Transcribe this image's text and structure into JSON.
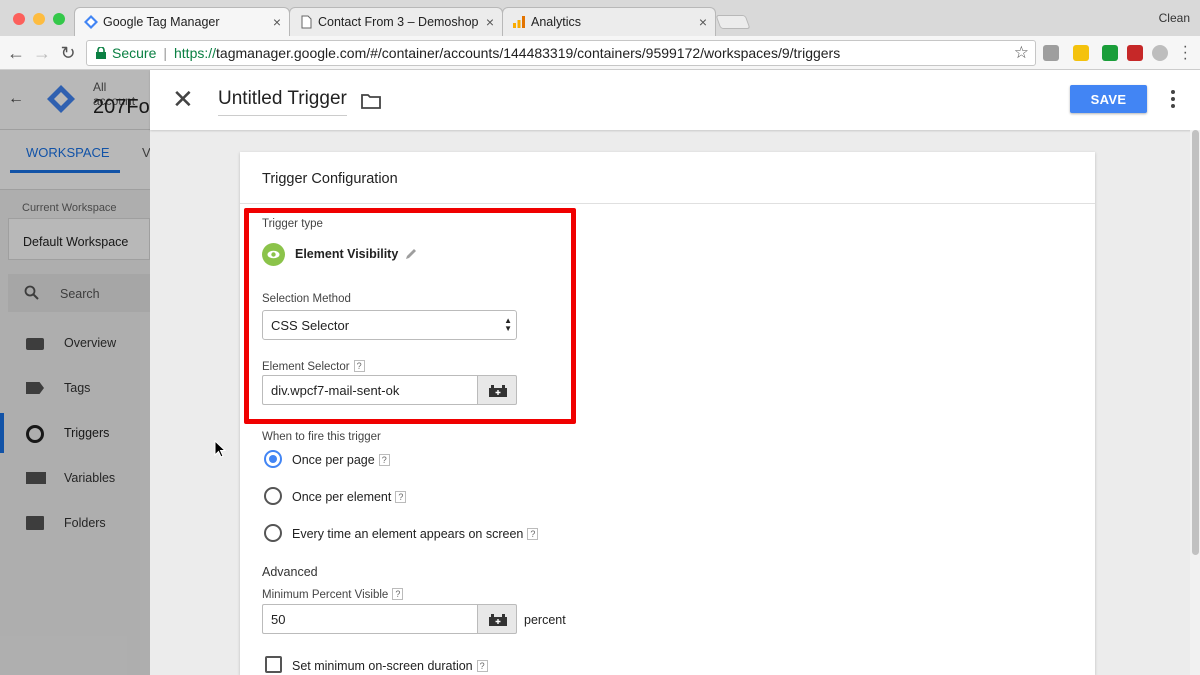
{
  "browser": {
    "tabs": [
      {
        "title": "Google Tag Manager",
        "active": true
      },
      {
        "title": "Contact From 3 – Demoshop",
        "active": false
      },
      {
        "title": "Analytics",
        "active": false
      }
    ],
    "profile_name": "Clean",
    "secure_label": "Secure",
    "url_scheme": "https://",
    "url_rest": "tagmanager.google.com/#/container/accounts/144483319/containers/9599172/workspaces/9/triggers"
  },
  "gtm": {
    "trigger_name": "Untitled Trigger",
    "save_label": "SAVE",
    "card_title": "Trigger Configuration",
    "trigger_type_label": "Trigger type",
    "trigger_type_value": "Element Visibility",
    "selection_method_label": "Selection Method",
    "selection_method_value": "CSS Selector",
    "element_selector_label": "Element Selector",
    "element_selector_value": "div.wpcf7-mail-sent-ok",
    "fire_label": "When to fire this trigger",
    "fire_options": [
      {
        "label": "Once per page",
        "selected": true
      },
      {
        "label": "Once per element",
        "selected": false
      },
      {
        "label": "Every time an element appears on screen",
        "selected": false
      }
    ],
    "advanced_label": "Advanced",
    "min_percent_label": "Minimum Percent Visible",
    "min_percent_value": "50",
    "percent_suffix": "percent",
    "min_duration_label": "Set minimum on-screen duration",
    "help_glyph": "?"
  },
  "colors": {
    "accent": "#4285f4",
    "highlight_box": "#f00000",
    "trigger_icon": "#8bc34a",
    "secure_green": "#0b8043"
  }
}
